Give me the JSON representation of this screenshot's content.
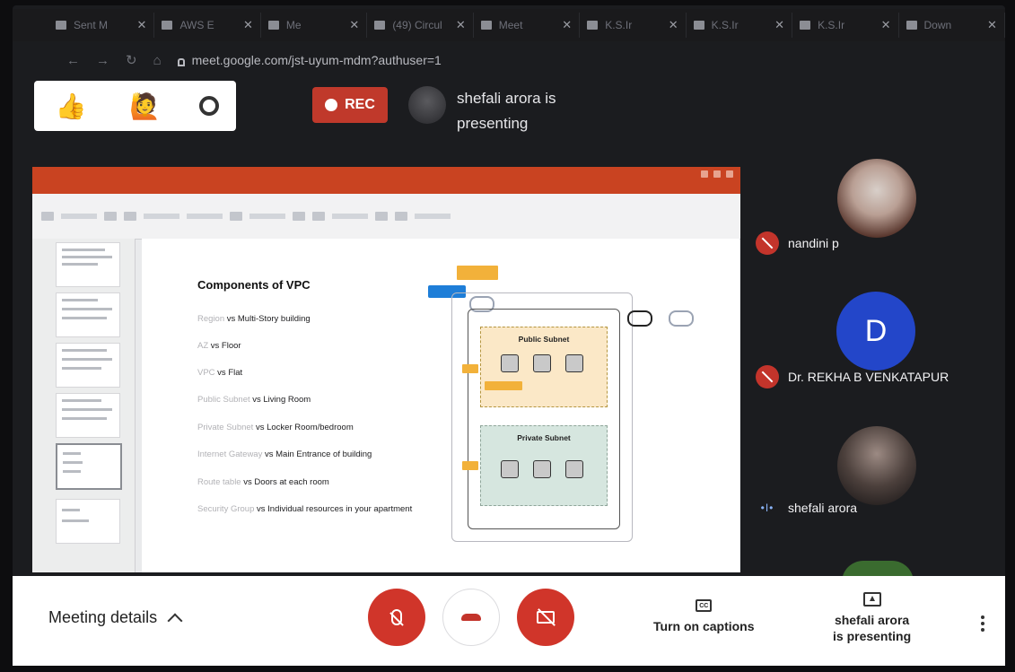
{
  "browser": {
    "tabs": [
      {
        "label": "Sent M"
      },
      {
        "label": "AWS E"
      },
      {
        "label": "Me"
      },
      {
        "label": "(49) Circul"
      },
      {
        "label": "Meet"
      },
      {
        "label": "K.S.Ir"
      },
      {
        "label": "K.S.Ir"
      },
      {
        "label": "K.S.Ir"
      },
      {
        "label": "Down"
      }
    ],
    "url": "meet.google.com/jst-uyum-mdm?authuser=1"
  },
  "reactions": [
    "👍",
    "🙋"
  ],
  "rec_label": "REC",
  "presenter_banner": {
    "line1": "shefali arora is",
    "line2": "presenting"
  },
  "slide": {
    "title": "Components of VPC",
    "items": [
      {
        "key": "Region",
        "desc": " vs Multi-Story building"
      },
      {
        "key": "AZ",
        "desc": " vs Floor"
      },
      {
        "key": "VPC",
        "desc": " vs Flat"
      },
      {
        "key": "Public Subnet",
        "desc": " vs Living Room"
      },
      {
        "key": "Private Subnet",
        "desc": " vs Locker Room/bedroom"
      },
      {
        "key": "Internet Gateway",
        "desc": " vs Main Entrance of building"
      },
      {
        "key": "Route table",
        "desc": " vs Doors at each room"
      },
      {
        "key": "Security Group",
        "desc": " vs Individual resources in your apartment"
      }
    ],
    "diagram": {
      "public_subnet": "Public Subnet",
      "private_subnet": "Private Subnet"
    }
  },
  "participants": [
    {
      "name": "nandini p",
      "state": "muted"
    },
    {
      "name": "Dr. REKHA B VENKATAPUR",
      "initial": "D",
      "state": "muted"
    },
    {
      "name": "shefali arora",
      "state": "speaking"
    }
  ],
  "bottom": {
    "meeting_details": "Meeting details",
    "captions": "Turn on captions",
    "cc": "CC",
    "presenting_line1": "shefali arora",
    "presenting_line2": "is presenting"
  }
}
